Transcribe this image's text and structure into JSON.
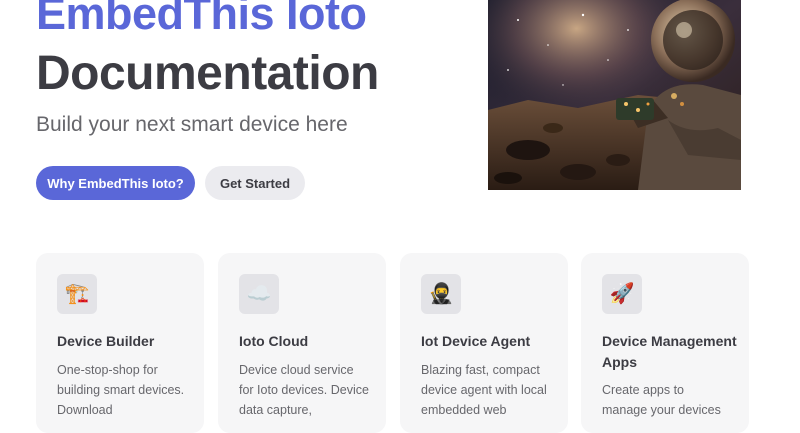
{
  "hero": {
    "name": "EmbedThis Ioto",
    "text": "Documentation",
    "tagline": "Build your next smart device here",
    "actions": [
      {
        "label": "Why EmbedThis Ioto?",
        "theme": "brand"
      },
      {
        "label": "Get Started",
        "theme": "alt"
      }
    ]
  },
  "features": [
    {
      "icon": "🏗️",
      "icon_name": "crane-icon",
      "title": "Device Builder",
      "details": "One-stop-shop for building smart devices. Download"
    },
    {
      "icon": "☁️",
      "icon_name": "cloud-icon",
      "title": "Ioto Cloud",
      "details": "Device cloud service for Ioto devices. Device data capture,"
    },
    {
      "icon": "🥷",
      "icon_name": "ninja-icon",
      "title": "Iot Device Agent",
      "details": "Blazing fast, compact device agent with local embedded web"
    },
    {
      "icon": "🚀",
      "icon_name": "rocket-icon",
      "title": "Device Management Apps",
      "details": "Create apps to manage your devices"
    }
  ],
  "colors": {
    "brand": "#5a67d8",
    "text": "#3c3c43",
    "muted": "#67676c",
    "card_bg": "#f6f6f7"
  }
}
